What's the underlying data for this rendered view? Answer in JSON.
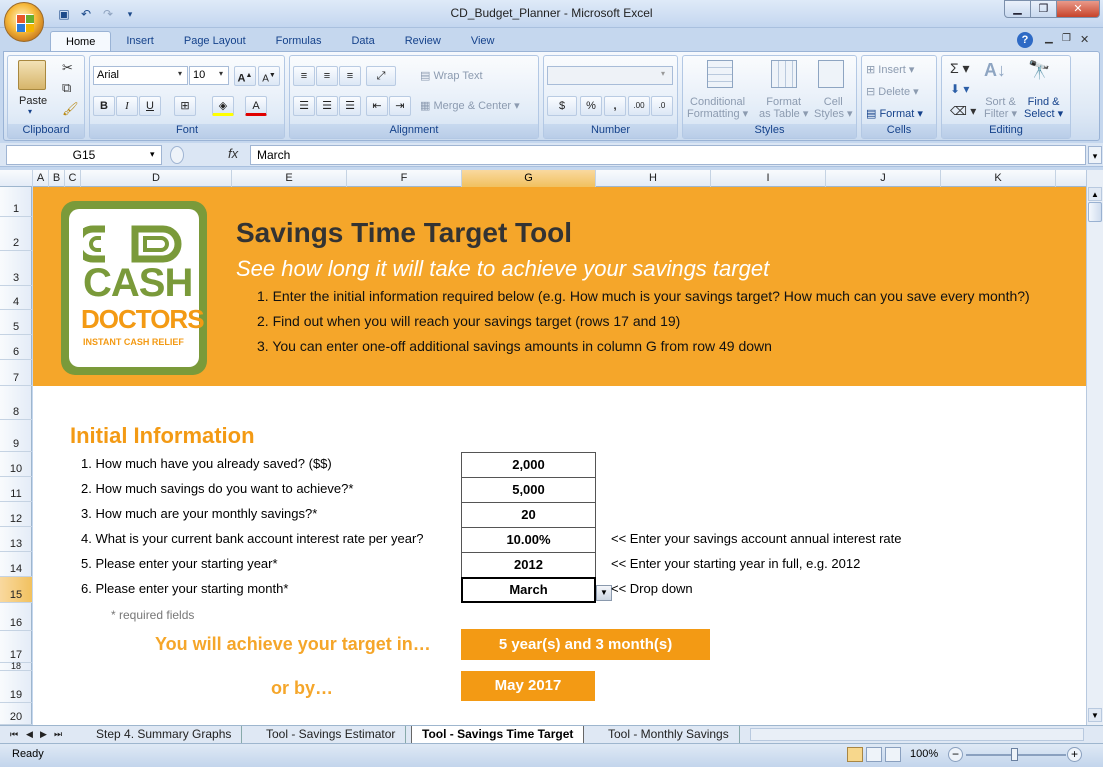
{
  "window": {
    "title": "CD_Budget_Planner - Microsoft Excel"
  },
  "ribbon_tabs": [
    "Home",
    "Insert",
    "Page Layout",
    "Formulas",
    "Data",
    "Review",
    "View"
  ],
  "ribbon": {
    "clipboard": {
      "label": "Clipboard",
      "paste": "Paste"
    },
    "font": {
      "label": "Font",
      "name": "Arial",
      "size": "10",
      "bold": "B",
      "italic": "I",
      "underline": "U"
    },
    "alignment": {
      "label": "Alignment",
      "wrap": "Wrap Text",
      "merge": "Merge & Center"
    },
    "number": {
      "label": "Number",
      "currency": "$",
      "percent": "%",
      "comma": ","
    },
    "styles": {
      "label": "Styles",
      "conditional1": "Conditional",
      "conditional2": "Formatting",
      "format_table1": "Format",
      "format_table2": "as Table",
      "cell_styles1": "Cell",
      "cell_styles2": "Styles"
    },
    "cells": {
      "label": "Cells",
      "insert": "Insert",
      "delete": "Delete",
      "format": "Format"
    },
    "editing": {
      "label": "Editing",
      "sort1": "Sort &",
      "sort2": "Filter",
      "find1": "Find &",
      "find2": "Select"
    }
  },
  "formula_bar": {
    "name_box": "G15",
    "fx": "fx",
    "value": "March"
  },
  "columns": [
    "A",
    "B",
    "C",
    "D",
    "E",
    "F",
    "G",
    "H",
    "I",
    "J",
    "K"
  ],
  "selected_column": "G",
  "rows": [
    "1",
    "2",
    "3",
    "4",
    "5",
    "6",
    "7",
    "8",
    "9",
    "10",
    "11",
    "12",
    "13",
    "14",
    "15",
    "16",
    "17",
    "18",
    "19",
    "20"
  ],
  "selected_row": "15",
  "sheet": {
    "logo": {
      "line1": "CASH",
      "line2": "DOCTORS",
      "tagline": "INSTANT CASH RELIEF"
    },
    "title": "Savings Time Target Tool",
    "subtitle": "See how long it will take to achieve your savings target",
    "instructions": [
      "1.  Enter the initial information required below (e.g. How much is your savings target?  How much can you save every month?)",
      "2.  Find out when you will reach your savings target (rows 17 and 19)",
      "3.  You can enter one-off additional savings amounts in column G from row 49 down"
    ],
    "section_title": "Initial Information",
    "questions": [
      {
        "label": "1. How much have you already saved? ($$)",
        "value": "2,000",
        "note": ""
      },
      {
        "label": "2. How much savings do you want to achieve?*",
        "value": "5,000",
        "note": ""
      },
      {
        "label": "3.  How much are your monthly savings?*",
        "value": "20",
        "note": ""
      },
      {
        "label": "4.  What is your current bank account interest rate per year?",
        "value": "10.00%",
        "note": "<< Enter your savings account annual interest rate"
      },
      {
        "label": "5.  Please enter your starting year*",
        "value": "2012",
        "note": "<< Enter your starting year in full, e.g. 2012"
      },
      {
        "label": "6.  Please enter your starting month*",
        "value": "March",
        "note": "<< Drop down"
      }
    ],
    "required_note": "* required fields",
    "result_label": "You will achieve your target in…",
    "result_value": "5 year(s) and 3 month(s)",
    "orby_label": "or by…",
    "orby_value": "May 2017"
  },
  "sheet_tabs": [
    "Step 4. Summary Graphs",
    "Tool - Savings Estimator",
    "Tool - Savings Time Target",
    "Tool - Monthly Savings"
  ],
  "active_sheet_tab": "Tool - Savings Time Target",
  "status": {
    "text": "Ready",
    "zoom": "100%"
  },
  "colors": {
    "banner": "#f5a62a",
    "accent_text": "#f39a14",
    "logo_green": "#7a9a3a"
  }
}
